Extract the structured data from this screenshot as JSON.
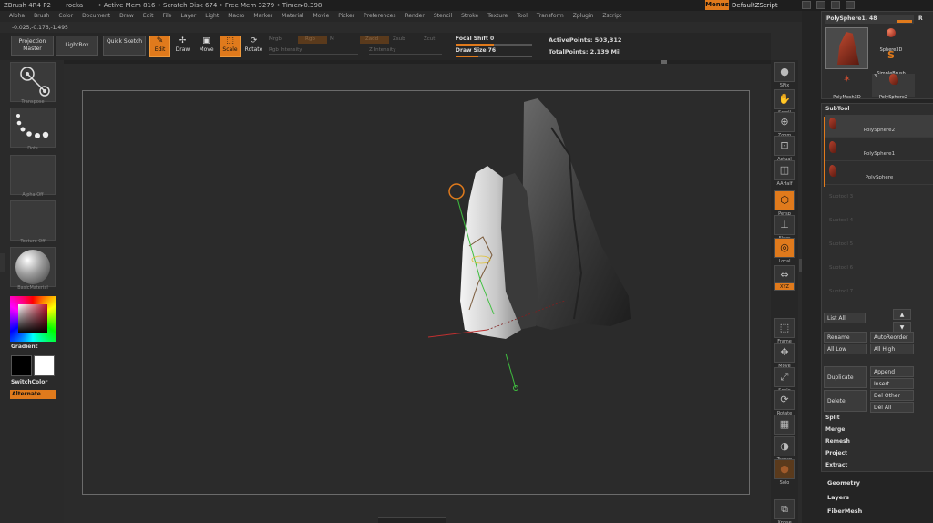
{
  "titlebar": {
    "app": "ZBrush 4R4 P2",
    "doc": "rocka",
    "mem": "• Active Mem 816 • Scratch Disk 674 • Free Mem 3279 • Timer▸0.398",
    "menus_button": "Menus",
    "script": "DefaultZScript"
  },
  "menubar": [
    "Alpha",
    "Brush",
    "Color",
    "Document",
    "Draw",
    "Edit",
    "File",
    "Layer",
    "Light",
    "Macro",
    "Marker",
    "Material",
    "Movie",
    "Picker",
    "Preferences",
    "Render",
    "Stencil",
    "Stroke",
    "Texture",
    "Tool",
    "Transform",
    "Zplugin",
    "Zscript"
  ],
  "coords": "-0.025,-0.176,-1.495",
  "toolbar": {
    "projection_master": "Projection Master",
    "lightbox": "LightBox",
    "quick_sketch": "Quick Sketch",
    "edit": "Edit",
    "draw": "Draw",
    "move": "Move",
    "scale": "Scale",
    "rotate": "Rotate",
    "mrgb": "Mrgb",
    "rgb": "Rgb",
    "m": "M",
    "zadd": "Zadd",
    "zsub": "Zsub",
    "zcut": "Zcut",
    "rgb_intensity": "Rgb Intensity",
    "z_intensity": "Z Intensity",
    "focal_shift_label": "Focal Shift",
    "focal_shift_value": "0",
    "focal_shift_fraction": 0.5,
    "draw_size_label": "Draw Size",
    "draw_size_value": "76",
    "draw_size_fraction": 0.3,
    "active_points": "ActivePoints: 503,312",
    "total_points": "TotalPoints: 2.139 Mil"
  },
  "leftshelf": {
    "brush_label": "Transpose",
    "stroke_label": "Dots",
    "alpha_label": "Alpha Off",
    "texture_label": "Texture Off",
    "material_label": "BasicMaterial",
    "gradient": "Gradient",
    "switch_color": "SwitchColor",
    "alternate": "Alternate",
    "colors": {
      "accent": "#e07a1c",
      "main": "#000000",
      "secondary": "#ffffff"
    }
  },
  "rightshelf": [
    "SPix",
    "Scroll",
    "Zoom",
    "Actual",
    "AAHalf",
    "Persp",
    "Floor",
    "Local",
    "L.Sym",
    "XYZ",
    "Frame",
    "Move",
    "Scale",
    "Rotate",
    "PolyF",
    "Transp",
    "Solo",
    "Xpose"
  ],
  "tool_panel": {
    "title": "PolySphere1. 48",
    "r_button": "R",
    "items": [
      "Sphere3D",
      "SimpleBrush",
      "PolyMesh3D",
      "PolySphere2"
    ],
    "count_badge": "3"
  },
  "subtool": {
    "title": "SubTool",
    "items": [
      "PolySphere2",
      "PolySphere1",
      "PolySphere"
    ],
    "empty_slots": [
      "Subtool 3",
      "Subtool 4",
      "Subtool 5",
      "Subtool 6",
      "Subtool 7"
    ],
    "list_all": "List All",
    "rename": "Rename",
    "auto_reorder": "AutoReorder",
    "all_low": "All Low",
    "all_high": "All High",
    "duplicate": "Duplicate",
    "append": "Append",
    "insert": "Insert",
    "delete": "Delete",
    "del_other": "Del Other",
    "del_all": "Del All",
    "split": "Split",
    "merge": "Merge",
    "remesh": "Remesh",
    "project": "Project",
    "extract": "Extract"
  },
  "sections": [
    "Geometry",
    "Layers",
    "FiberMesh"
  ]
}
